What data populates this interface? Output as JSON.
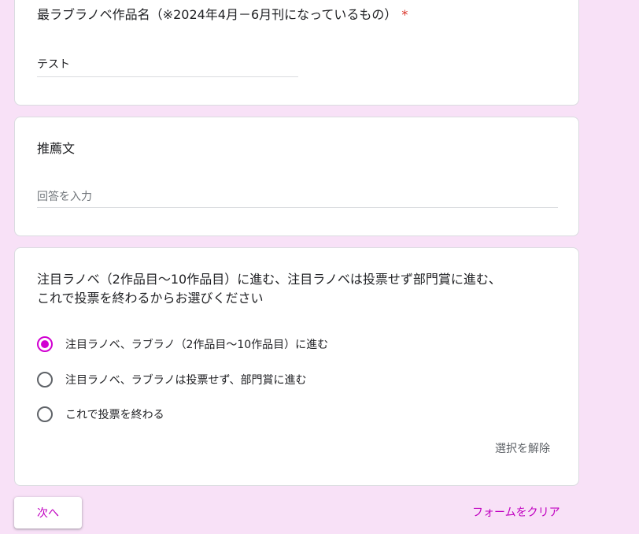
{
  "q1": {
    "title": "最ラブラノベ作品名（※2024年4月－6月刊になっているもの）",
    "required_mark": "*",
    "answer": "テスト"
  },
  "q2": {
    "title": "推薦文",
    "placeholder": "回答を入力"
  },
  "q3": {
    "title_line1": "注目ラノベ（2作品目〜10作品目）に進む、注目ラノベは投票せず部門賞に進む、",
    "title_line2": "これで投票を終わるからお選びください",
    "options": [
      {
        "label": "注目ラノベ、ラブラノ（2作品目〜10作品目）に進む",
        "selected": true
      },
      {
        "label": "注目ラノベ、ラブラノは投票せず、部門賞に進む",
        "selected": false
      },
      {
        "label": "これで投票を終わる",
        "selected": false
      }
    ],
    "clear_selection": "選択を解除"
  },
  "footer": {
    "next_button": "次へ",
    "clear_form": "フォームをクリア"
  },
  "colors": {
    "background": "#f8e1f7",
    "accent": "#d100d1",
    "link": "#c000c0",
    "required": "#d93025"
  }
}
